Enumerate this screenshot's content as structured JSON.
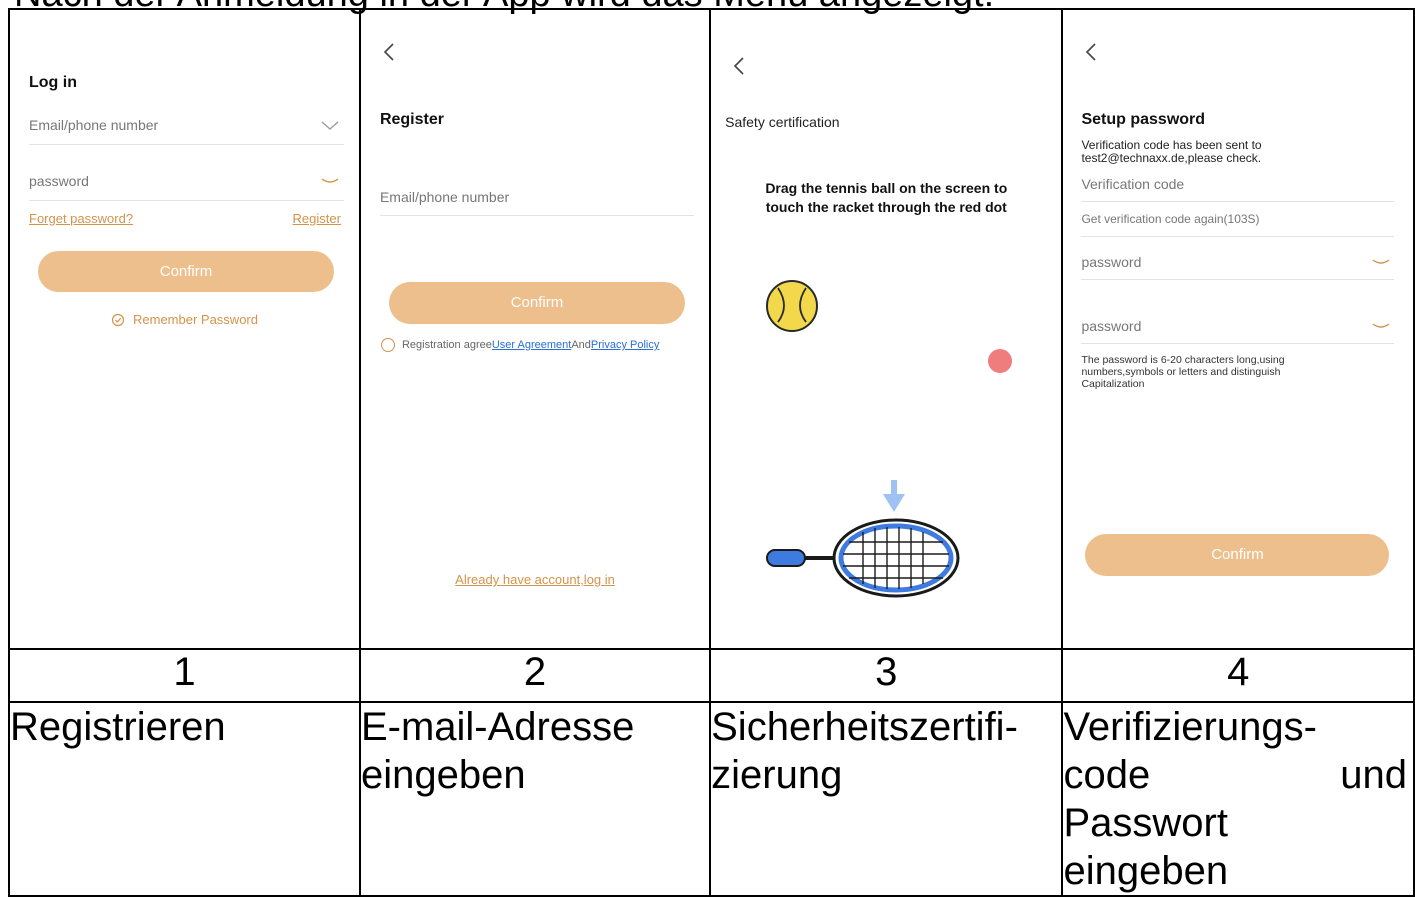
{
  "top_caption": "Nach der Anmeldung in der App wird das Menü angezeigt:",
  "screen1": {
    "title": "Log in",
    "email_placeholder": "Email/phone number",
    "password_placeholder": "password",
    "forget_link": "Forget password?",
    "register_link": "Register",
    "confirm_label": "Confirm",
    "remember_label": "Remember Password"
  },
  "screen2": {
    "back_icon": "chevron-left-icon",
    "title": "Register",
    "email_placeholder": "Email/phone number",
    "confirm_label": "Confirm",
    "agree_text": "Registration agree",
    "user_agreement": "User Agreement",
    "and_text": "And",
    "privacy_policy": "Privacy Policy",
    "login_link": "Already have account,log in"
  },
  "screen3": {
    "back_icon": "chevron-left-icon",
    "title": "Safety certification",
    "instruction_line1": "Drag the tennis ball on the screen to",
    "instruction_line2": "touch the racket through the red dot"
  },
  "screen4": {
    "back_icon": "chevron-left-icon",
    "title": "Setup password",
    "sent_line1": "Verification code has been sent to",
    "sent_line2": "test2@technaxx.de,please check.",
    "code_placeholder": "Verification code",
    "resend_text": "Get verification code again(103S)",
    "password1_placeholder": "password",
    "password2_placeholder": "password",
    "hint_line1": "The password is 6-20 characters long,using",
    "hint_line2": "numbers,symbols or letters and distinguish",
    "hint_line3": "Capitalization",
    "confirm_label": "Confirm"
  },
  "numbers": [
    "1",
    "2",
    "3",
    "4"
  ],
  "captions": {
    "c1": "Registrieren",
    "c2_line1": "E-mail-Adresse",
    "c2_line2": "eingeben",
    "c3_line1": "Sicherheitszertifi-",
    "c3_line2": "zierung",
    "c4_line1": "Verifizierungs-",
    "c4_line2a": "code",
    "c4_line2b": "und",
    "c4_line3": "Passwort",
    "c4_line4": "eingeben"
  },
  "colors": {
    "button": "#edbf8c",
    "link_orange": "#d4934a",
    "link_blue": "#2a6fd6",
    "ball": "#f2d84a",
    "red_dot": "#ef7d7d",
    "racket": "#3d7be0"
  }
}
